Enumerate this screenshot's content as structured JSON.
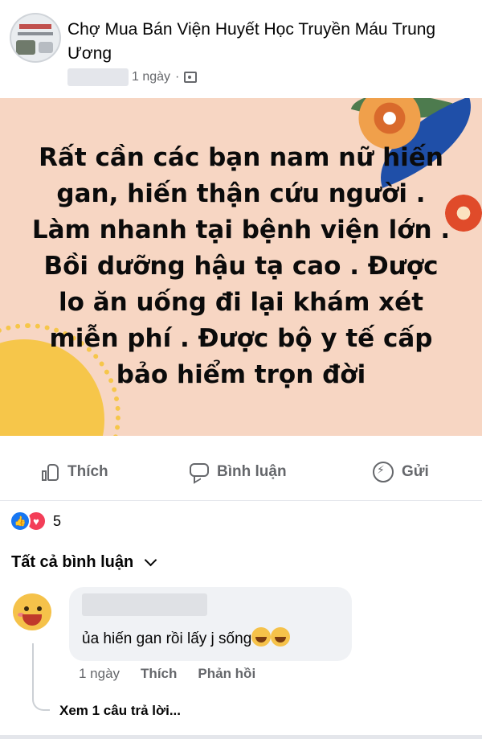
{
  "post": {
    "group_name": "Chợ Mua Bán Viện Huyết Học Truyền Máu Trung Ương",
    "time": "1 ngày",
    "separator": "·",
    "image_text": "Rất cần các bạn nam nữ hiến\ngan, hiến thận  cứu người .\nLàm nhanh tại bệnh viện lớn .\nBồi dưỡng hậu tạ cao . Được\nlo ăn uống đi lại khám xét\nmiễn phí . Được bộ y tế cấp\nbảo hiểm trọn đời",
    "background_color": "#f7d6c3"
  },
  "actions": {
    "like": "Thích",
    "comment": "Bình luận",
    "send": "Gửi"
  },
  "reactions": {
    "count": "5",
    "icons": [
      "like-icon",
      "love-icon"
    ]
  },
  "comments_filter": {
    "label": "Tất cả bình luận"
  },
  "comment": {
    "text": "ủa hiến gan rồi lấy j sống",
    "emojis": [
      "rofl-emoji",
      "rofl-emoji"
    ],
    "time": "1 ngày",
    "like": "Thích",
    "reply": "Phản hồi",
    "view_replies": "Xem 1 câu trả lời..."
  },
  "colors": {
    "accent_blue": "#1877f2",
    "love_red": "#f33e58",
    "muted_text": "#65676b"
  }
}
